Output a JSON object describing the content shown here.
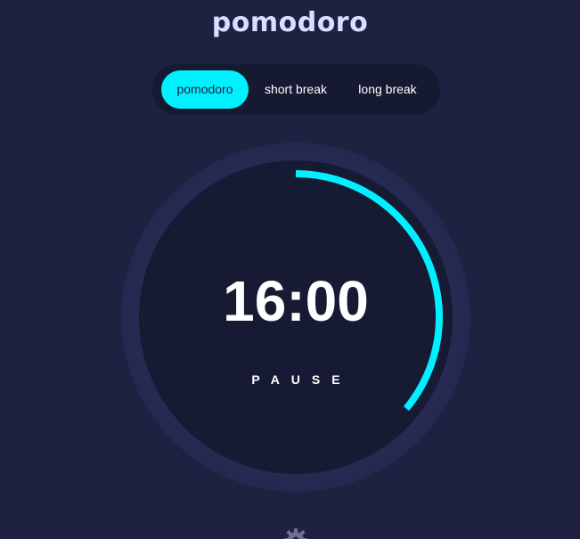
{
  "app": {
    "title": "pomodoro"
  },
  "tabs": [
    {
      "label": "pomodoro",
      "active": true
    },
    {
      "label": "short break",
      "active": false
    },
    {
      "label": "long break",
      "active": false
    }
  ],
  "timer": {
    "time": "16:00",
    "action_label": "PAUSE",
    "progress_fraction": 0.36
  },
  "colors": {
    "accent": "#00f0ff",
    "background": "#1e2140",
    "face": "#161a33",
    "title": "#d7e0ff"
  },
  "icons": {
    "settings": "gear-icon"
  }
}
